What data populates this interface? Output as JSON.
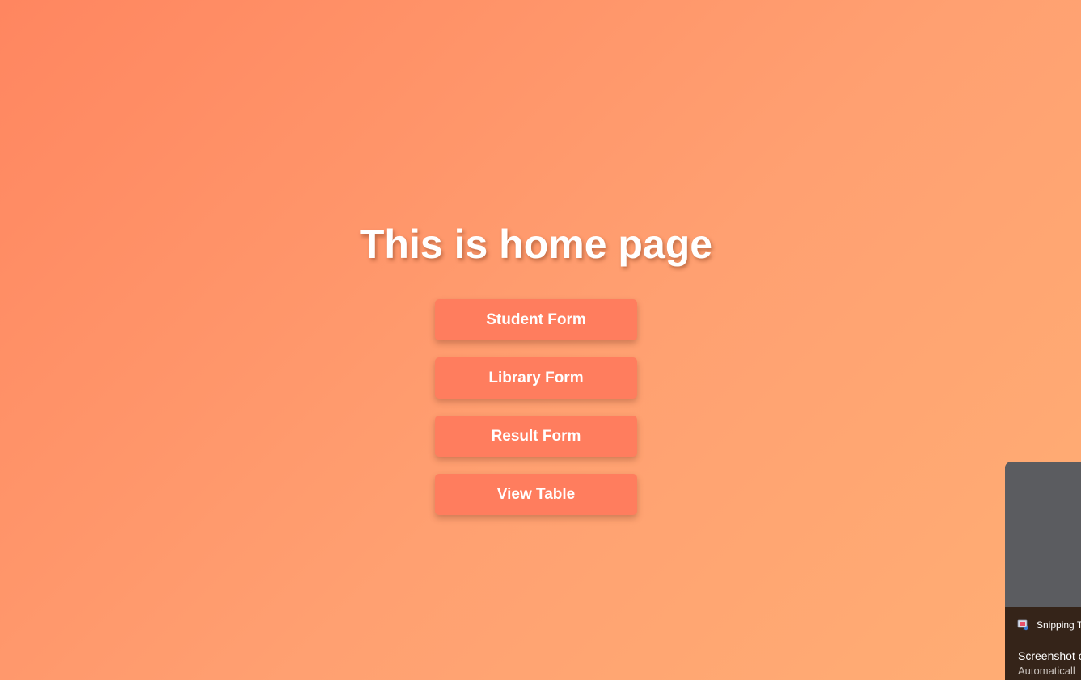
{
  "page": {
    "title": "This is home page"
  },
  "nav": {
    "buttons": [
      {
        "label": "Student Form"
      },
      {
        "label": "Library Form"
      },
      {
        "label": "Result Form"
      },
      {
        "label": "View Table"
      }
    ]
  },
  "toast": {
    "app_name": "Snipping T",
    "title": "Screenshot c",
    "subtitle": "Automaticall",
    "app_icon": "snipping-tool-icon"
  },
  "colors": {
    "background_start": "#ff8660",
    "background_end": "#ffae74",
    "button": "#ff7d5e",
    "text": "#ffffff"
  }
}
